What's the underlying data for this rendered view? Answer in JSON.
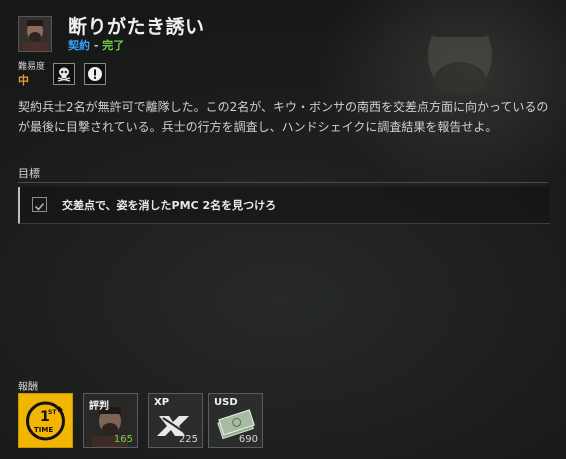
{
  "quest": {
    "title": "断りがたき誘い",
    "category": "契約",
    "separator": " - ",
    "status": "完了",
    "difficulty_label": "難易度",
    "difficulty_value": "中",
    "description": "契約兵士2名が無許可で離隊した。この2名が、キウ・ボンサの南西を交差点方面に向かっているのが最後に目撃されている。兵士の行方を調査し、ハンドシェイクに調査結果を報告せよ。"
  },
  "objectives": {
    "label": "目標",
    "items": [
      {
        "text": "交差点で、姿を消したPMC 2名を見つけろ"
      }
    ]
  },
  "rewards": {
    "label": "報酬",
    "items": [
      {
        "label": "",
        "value": "",
        "icon": "first-time-icon"
      },
      {
        "label": "評判",
        "value": "165",
        "icon": "faction-avatar"
      },
      {
        "label": "XP",
        "value": "225",
        "icon": "xp-icon"
      },
      {
        "label": "USD",
        "value": "690",
        "icon": "cash-icon"
      }
    ]
  },
  "colors": {
    "category": "#3aa0ff",
    "status": "#6fd24a",
    "difficulty": "#e69a2e",
    "reputation": "#6fd24a",
    "first_time_bg": "#f2b500"
  }
}
